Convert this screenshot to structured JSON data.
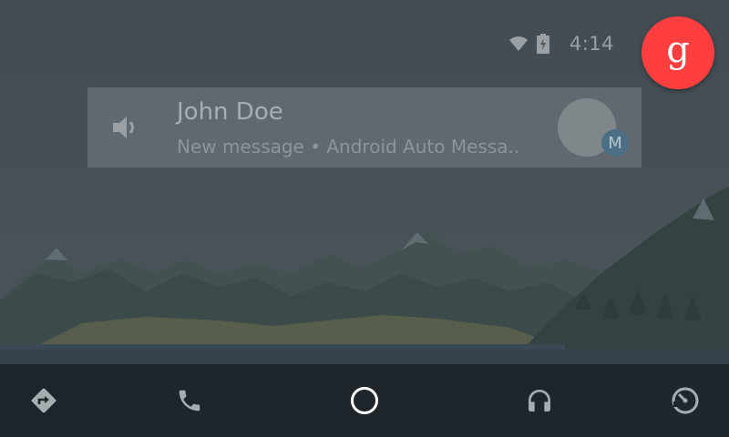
{
  "status_bar": {
    "wifi_icon": "wifi-icon",
    "battery_icon": "battery-charging-icon",
    "time": "4:14"
  },
  "google_button": {
    "glyph": "g",
    "icon": "google-g-icon",
    "color": "#ff3f3f"
  },
  "notification": {
    "title": "John Doe",
    "subtitle": "New message • Android Auto Messa..",
    "speaker_icon": "speaker-icon",
    "app_badge_letter": "M",
    "app_badge_color": "#4d6f86"
  },
  "nav_bar": {
    "items": [
      {
        "name": "navigation",
        "icon": "directions-icon"
      },
      {
        "name": "phone",
        "icon": "phone-icon"
      },
      {
        "name": "home",
        "icon": "home-circle-icon"
      },
      {
        "name": "music",
        "icon": "headphones-icon"
      },
      {
        "name": "car",
        "icon": "speedometer-icon"
      }
    ],
    "background": "#1e262c"
  }
}
